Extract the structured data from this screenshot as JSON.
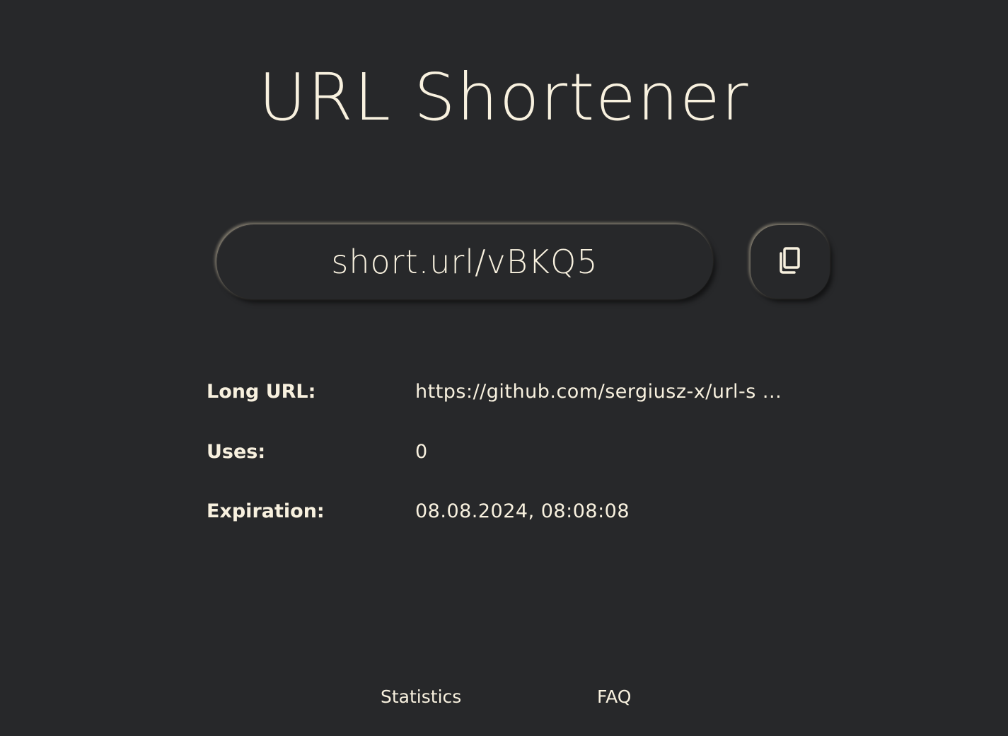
{
  "header": {
    "title": "URL Shortener"
  },
  "short_url": {
    "value": "short.url/vBKQ5",
    "copy_icon": "copy-icon"
  },
  "details": {
    "long_url_label": "Long URL:",
    "long_url_value": "https://github.com/sergiusz-x/url-s ...",
    "uses_label": "Uses:",
    "uses_value": "0",
    "expiration_label": "Expiration:",
    "expiration_value": "08.08.2024, 08:08:08"
  },
  "footer": {
    "statistics_label": "Statistics",
    "faq_label": "FAQ"
  },
  "colors": {
    "background": "#27282a",
    "text": "#f8f1df"
  }
}
